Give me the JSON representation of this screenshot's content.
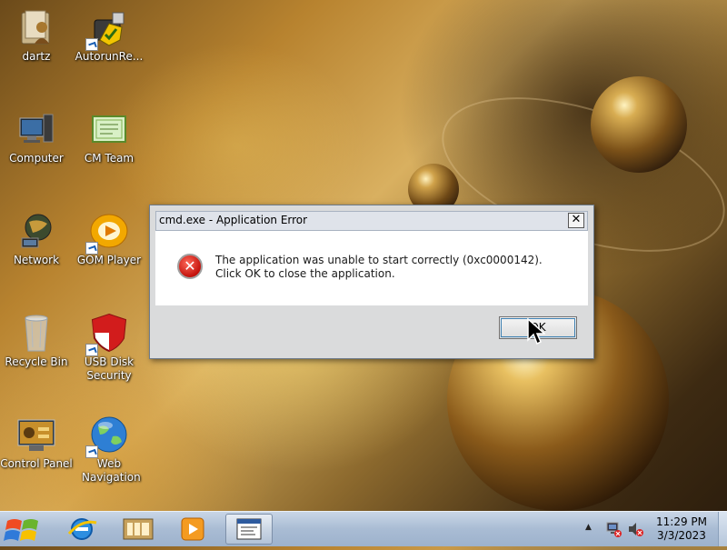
{
  "desktop": {
    "icons": [
      {
        "label": "dartz",
        "icon": "user-folder-icon"
      },
      {
        "label": "AutorunRe...",
        "icon": "usb-shield-icon"
      },
      {
        "label": "Computer",
        "icon": "computer-icon"
      },
      {
        "label": "CM Team",
        "icon": "certificate-icon"
      },
      {
        "label": "Network",
        "icon": "network-globe-icon"
      },
      {
        "label": "GOM Player",
        "icon": "gom-player-icon"
      },
      {
        "label": "Recycle Bin",
        "icon": "recycle-bin-icon"
      },
      {
        "label": "USB Disk Security",
        "icon": "usb-disk-security-icon"
      },
      {
        "label": "Control Panel",
        "icon": "control-panel-icon"
      },
      {
        "label": "Web Navigation",
        "icon": "web-navigation-icon"
      }
    ]
  },
  "dialog": {
    "title": "cmd.exe - Application Error",
    "close_symbol": "✕",
    "message": "The application was unable to start correctly (0xc0000142). Click OK to close the application.",
    "ok_label": "OK",
    "icon": "error-icon"
  },
  "taskbar": {
    "start": "start-orb-icon",
    "pinned": [
      "internet-explorer-icon",
      "library-icon",
      "media-player-icon",
      "cmd-window-icon"
    ],
    "tray": {
      "show_hidden": "▲",
      "network": "network-tray-icon",
      "volume": "volume-muted-icon"
    },
    "clock": {
      "time": "11:29 PM",
      "date": "3/3/2023"
    }
  },
  "colors": {
    "dialog_bg": "#dadbdc",
    "error_red": "#c3120c",
    "taskbar": "#a9bcd4"
  }
}
